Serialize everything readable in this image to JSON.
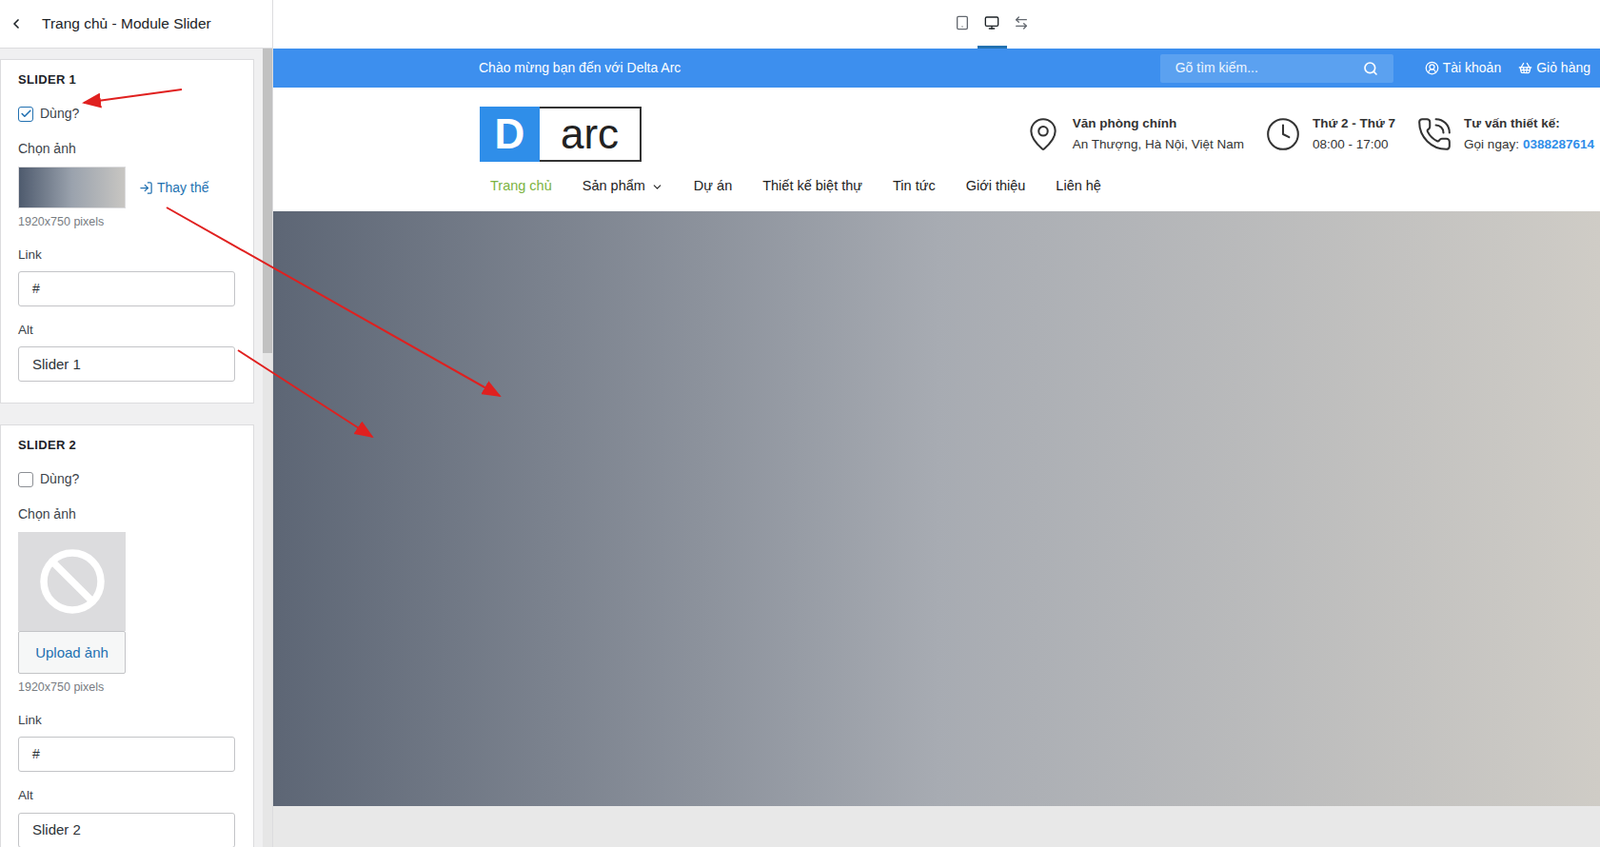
{
  "panel": {
    "title": "Trang chủ - Module Slider",
    "sliders": [
      {
        "heading": "SLIDER 1",
        "use_label": "Dùng?",
        "checked": true,
        "image_label": "Chọn ảnh",
        "has_image": true,
        "replace": "Thay thế",
        "upload": "",
        "size": "1920x750 pixels",
        "link_label": "Link",
        "link": "#",
        "alt_label": "Alt",
        "alt": "Slider 1"
      },
      {
        "heading": "SLIDER 2",
        "use_label": "Dùng?",
        "checked": false,
        "image_label": "Chọn ảnh",
        "has_image": false,
        "replace": "",
        "upload": "Upload ảnh",
        "size": "1920x750 pixels",
        "link_label": "Link",
        "link": "#",
        "alt_label": "Alt",
        "alt": "Slider 2"
      }
    ]
  },
  "toolbar": {
    "devices": [
      {
        "kind": "tablet",
        "selected": false
      },
      {
        "kind": "desktop",
        "selected": true
      },
      {
        "kind": "fullwidth",
        "selected": false
      }
    ]
  },
  "site": {
    "topbar": {
      "welcome": "Chào mừng bạn đến với Delta Arc",
      "search_placeholder": "Gõ tìm kiếm...",
      "account": "Tài khoản",
      "cart": "Giỏ hàng"
    },
    "logo": {
      "mark": "D",
      "text": "arc"
    },
    "info": [
      {
        "kind": "location",
        "title": "Văn phòng chính",
        "detail": "An Thượng, Hà Nội, Việt Nam",
        "highlight": ""
      },
      {
        "kind": "hours",
        "title": "Thứ 2 - Thứ 7",
        "detail": "08:00 - 17:00",
        "highlight": ""
      },
      {
        "kind": "phone",
        "title": "Tư vấn thiết kế:",
        "detail": "Gọi ngay:",
        "highlight": "0388287614"
      }
    ],
    "nav": [
      {
        "label": "Trang chủ",
        "selected": true,
        "dropdown": false
      },
      {
        "label": "Sản phẩm",
        "selected": false,
        "dropdown": true
      },
      {
        "label": "Dự án",
        "selected": false,
        "dropdown": false
      },
      {
        "label": "Thiết kế biệt thự",
        "selected": false,
        "dropdown": false
      },
      {
        "label": "Tin tức",
        "selected": false,
        "dropdown": false
      },
      {
        "label": "Giới thiệu",
        "selected": false,
        "dropdown": false
      },
      {
        "label": "Liên hệ",
        "selected": false,
        "dropdown": false
      }
    ]
  }
}
